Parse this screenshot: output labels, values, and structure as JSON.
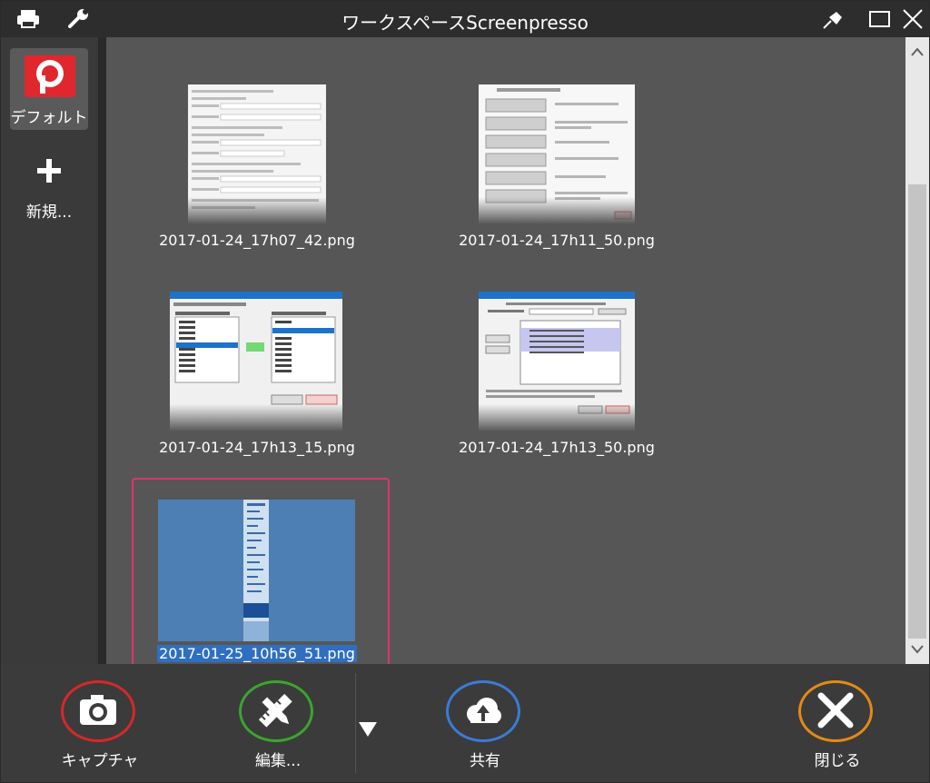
{
  "window": {
    "title": "ワークスペースScreenpresso"
  },
  "titlebar": {
    "icons": [
      "printer-icon",
      "wrench-icon",
      "pin-icon",
      "maximize-icon",
      "close-icon"
    ]
  },
  "workspaces": {
    "items": [
      {
        "label": "デフォルト",
        "icon": "screenpresso-logo"
      },
      {
        "label": "新規...",
        "icon": "plus-icon"
      }
    ]
  },
  "gallery": {
    "items": [
      {
        "filename": "2017-01-24_17h07_42.png"
      },
      {
        "filename": "2017-01-24_17h11_50.png"
      },
      {
        "filename": "2017-01-24_17h13_15.png"
      },
      {
        "filename": "2017-01-24_17h13_50.png"
      },
      {
        "filename": "2017-01-25_10h56_51.png",
        "selected": true
      }
    ]
  },
  "toolbar": {
    "capture_label": "キャプチャ",
    "edit_label": "編集...",
    "share_label": "共有",
    "close_label": "閉じる"
  },
  "colors": {
    "capture_ring": "#d62828",
    "edit_ring": "#3aa52e",
    "share_ring": "#3b7bd4",
    "close_ring": "#e38a17",
    "selection_frame": "#e0336a",
    "selection_text_bg": "#2f6fc1"
  }
}
